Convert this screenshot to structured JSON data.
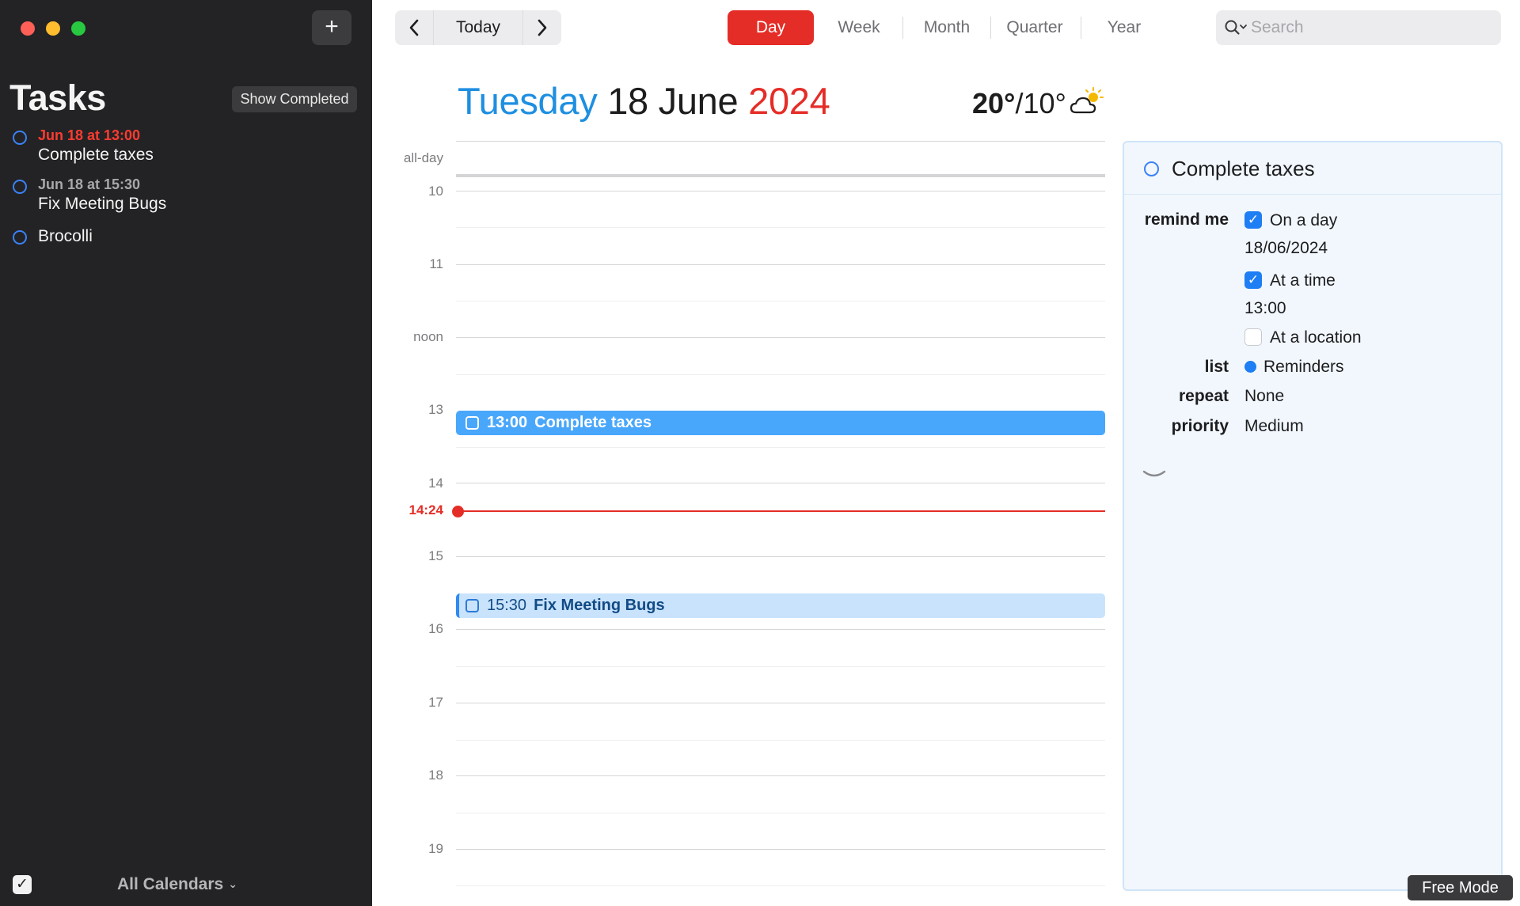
{
  "sidebar": {
    "add_label": "+",
    "title": "Tasks",
    "show_completed_label": "Show Completed",
    "tasks": [
      {
        "meta": "Jun 18 at 13:00",
        "title": "Complete taxes",
        "overdue": true
      },
      {
        "meta": "Jun 18 at 15:30",
        "title": "Fix Meeting Bugs",
        "overdue": false
      },
      {
        "meta": "",
        "title": "Brocolli",
        "overdue": false
      }
    ],
    "footer": {
      "calendars_label": "All Calendars",
      "check_glyph": "✓"
    }
  },
  "toolbar": {
    "today_label": "Today",
    "views": [
      "Day",
      "Week",
      "Month",
      "Quarter",
      "Year"
    ],
    "active_view": "Day",
    "search": {
      "placeholder": "Search",
      "value": ""
    }
  },
  "date_header": {
    "weekday": "Tuesday",
    "day_month": "18 June",
    "year": "2024"
  },
  "weather": {
    "high": "20°",
    "low": "/10°",
    "icon": "partly-sunny-icon"
  },
  "day_grid": {
    "all_day_label": "all-day",
    "hours": [
      "10",
      "11",
      "noon",
      "13",
      "14",
      "15",
      "16",
      "17",
      "18",
      "19"
    ],
    "now_label": "14:24",
    "events": [
      {
        "time": "13:00",
        "title": "Complete taxes"
      },
      {
        "time": "15:30",
        "title": "Fix Meeting Bugs"
      }
    ]
  },
  "detail": {
    "title": "Complete taxes",
    "remind_me_label": "remind me",
    "on_a_day_label": "On a day",
    "on_a_day_checked": true,
    "date_value": "18/06/2024",
    "at_a_time_label": "At a time",
    "at_a_time_checked": true,
    "time_value": "13:00",
    "at_a_location_label": "At a location",
    "at_a_location_checked": false,
    "list_label": "list",
    "list_value": "Reminders",
    "repeat_label": "repeat",
    "repeat_value": "None",
    "priority_label": "priority",
    "priority_value": "Medium"
  },
  "overlay": {
    "free_mode_label": "Free Mode"
  },
  "colors": {
    "accent_red": "#e52d27",
    "accent_blue": "#1e8fe1",
    "event_blue": "#49a7fb",
    "sidebar_bg": "#232325"
  }
}
